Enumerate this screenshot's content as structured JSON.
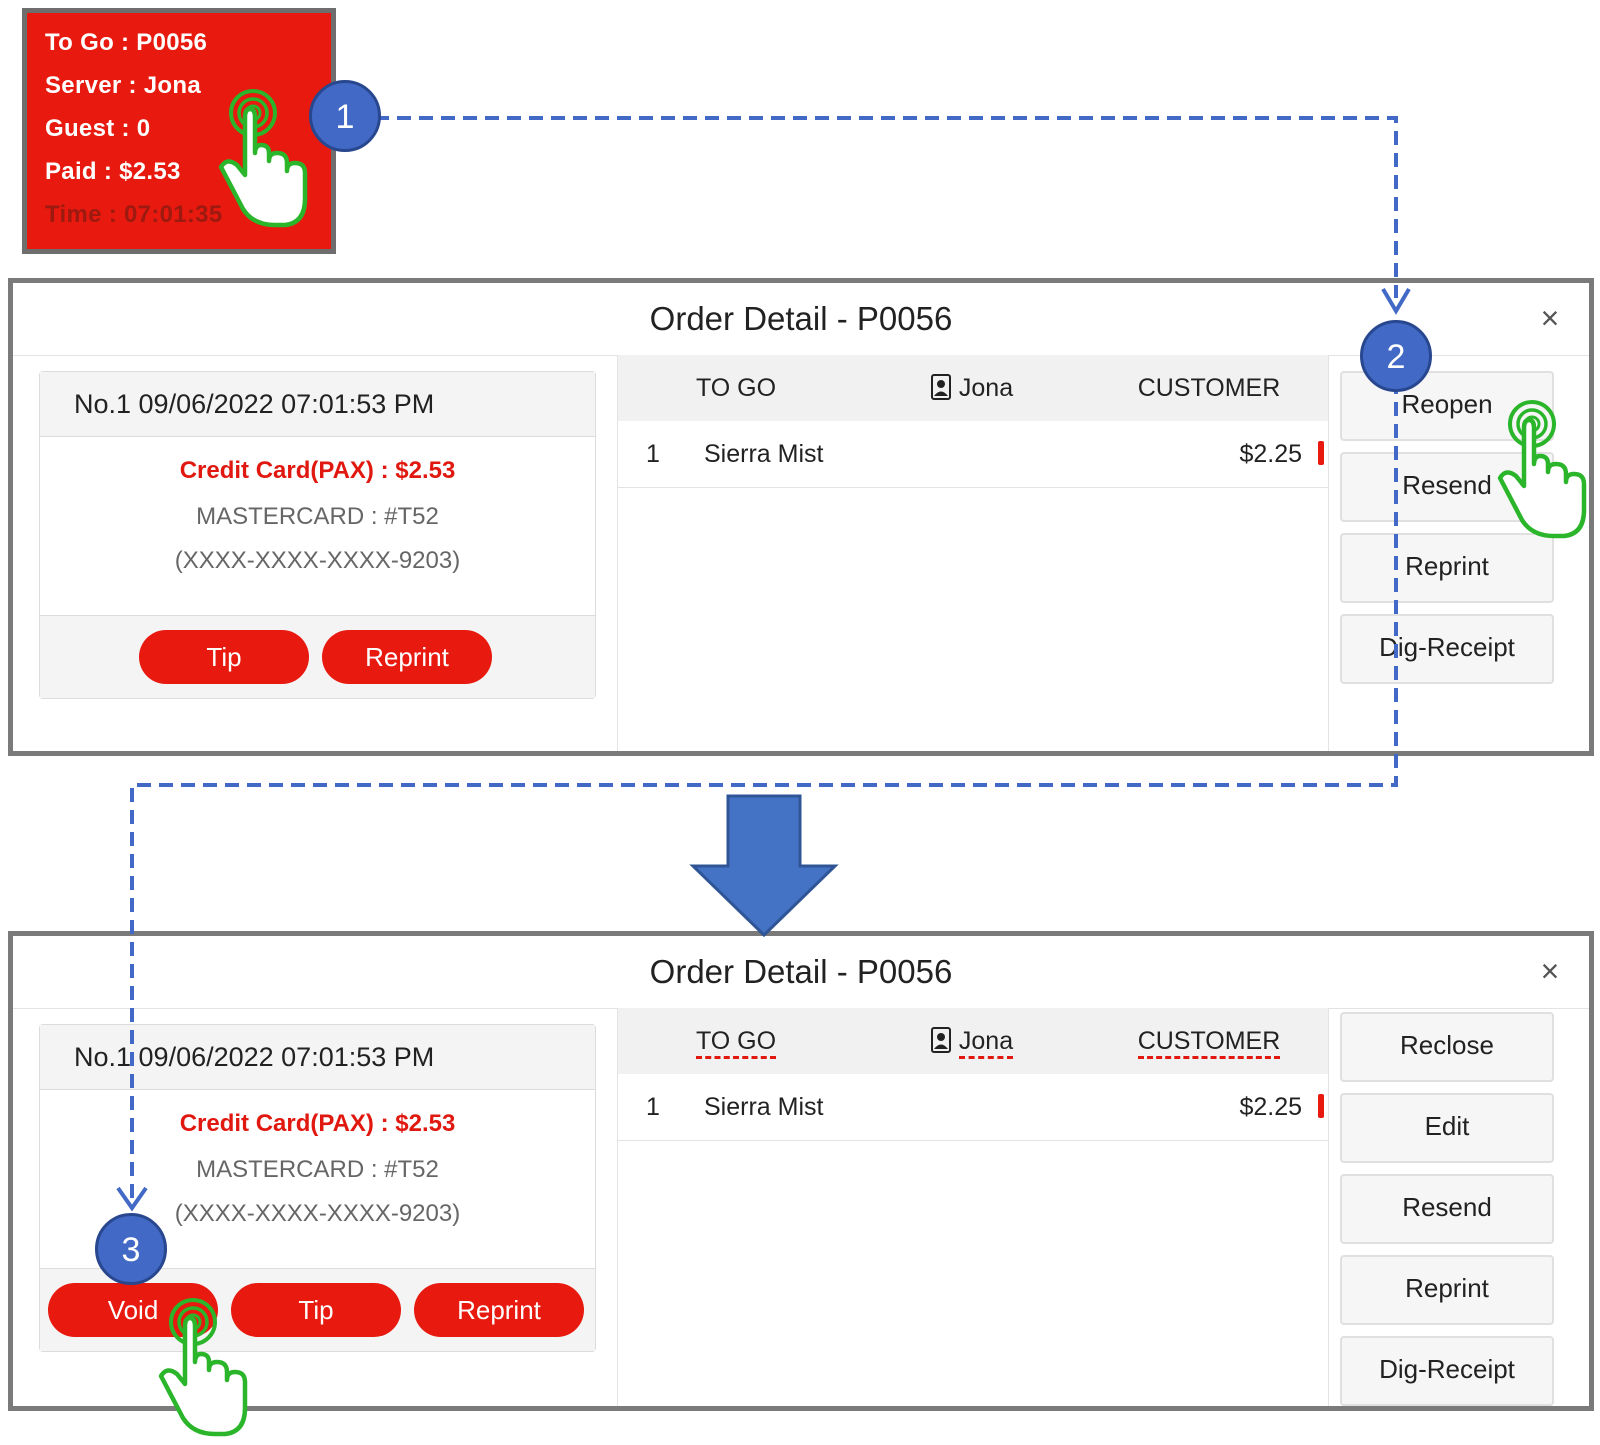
{
  "ticket": {
    "type_label": "To Go  :  P0056",
    "server_label": "Server  :  Jona",
    "guest_label": "Guest  :  0",
    "paid_label": "Paid  :  $2.53",
    "time_label": "Time  :  07:01:35"
  },
  "steps": [
    "1",
    "2",
    "3"
  ],
  "dialog_before": {
    "title": "Order Detail - P0056",
    "close": "×",
    "payment": {
      "header": "No.1  09/06/2022 07:01:53 PM",
      "method": "Credit Card(PAX) : $2.53",
      "card": "MASTERCARD : #T52",
      "mask": "(XXXX-XXXX-XXXX-9203)",
      "buttons": [
        "Tip",
        "Reprint"
      ]
    },
    "columns": [
      "TO GO",
      "Jona",
      "CUSTOMER"
    ],
    "items": [
      {
        "qty": "1",
        "name": "Sierra Mist",
        "price": "$2.25"
      }
    ],
    "actions": [
      "Reopen",
      "Resend",
      "Reprint",
      "Dig-Receipt"
    ]
  },
  "dialog_after": {
    "title": "Order Detail - P0056",
    "close": "×",
    "payment": {
      "header": "No.1  09/06/2022 07:01:53 PM",
      "method": "Credit Card(PAX) : $2.53",
      "card": "MASTERCARD : #T52",
      "mask": "(XXXX-XXXX-XXXX-9203)",
      "buttons": [
        "Void",
        "Tip",
        "Reprint"
      ]
    },
    "columns": [
      "TO GO",
      "Jona",
      "CUSTOMER"
    ],
    "items": [
      {
        "qty": "1",
        "name": "Sierra Mist",
        "price": "$2.25"
      }
    ],
    "actions": [
      "Reclose",
      "Edit",
      "Resend",
      "Reprint",
      "Dig-Receipt"
    ]
  },
  "colors": {
    "accent_red": "#e8190e",
    "step_blue": "#4169c5",
    "tap_green": "#2bb52b",
    "connector": "#4169c5"
  },
  "icons": [
    "person-badge-icon",
    "tap-hand-icon",
    "close-icon",
    "down-arrow-icon"
  ]
}
